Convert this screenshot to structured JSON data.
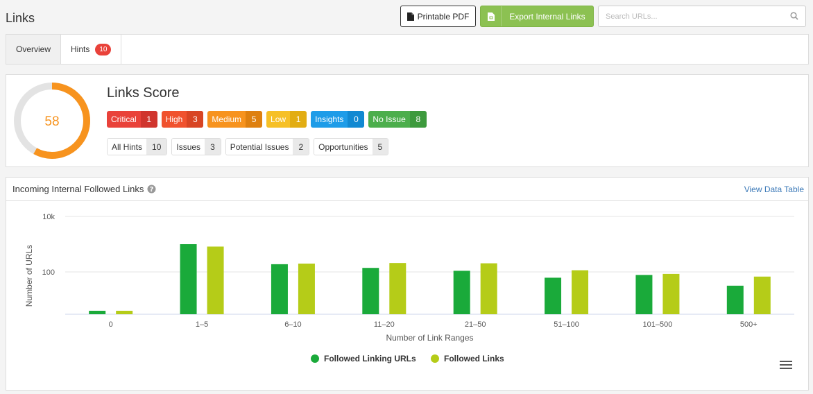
{
  "page": {
    "title": "Links"
  },
  "toolbar": {
    "pdf_label": "Printable PDF",
    "export_label": "Export Internal Links"
  },
  "search": {
    "placeholder": "Search URLs..."
  },
  "tabs": [
    {
      "label": "Overview",
      "active": true
    },
    {
      "label": "Hints",
      "badge": "10",
      "active": false
    }
  ],
  "score": {
    "title": "Links Score",
    "value": "58",
    "fraction": 0.58,
    "ring_color": "#f7931e",
    "severities": [
      {
        "label": "Critical",
        "count": "1",
        "color": "#e9423a",
        "dark": "#d0352e"
      },
      {
        "label": "High",
        "count": "3",
        "color": "#f0522e",
        "dark": "#d84524"
      },
      {
        "label": "Medium",
        "count": "5",
        "color": "#f7931e",
        "dark": "#de8010"
      },
      {
        "label": "Low",
        "count": "1",
        "color": "#f6c026",
        "dark": "#e2ad13"
      },
      {
        "label": "Insights",
        "count": "0",
        "color": "#1e9ce8",
        "dark": "#1189d2"
      },
      {
        "label": "No Issue",
        "count": "8",
        "color": "#4cae4c",
        "dark": "#3d9a3d"
      }
    ],
    "counts": [
      {
        "label": "All Hints",
        "count": "10"
      },
      {
        "label": "Issues",
        "count": "3"
      },
      {
        "label": "Potential Issues",
        "count": "2"
      },
      {
        "label": "Opportunities",
        "count": "5"
      }
    ]
  },
  "chart_panel": {
    "title": "Incoming Internal Followed Links",
    "view_link": "View Data Table"
  },
  "chart_data": {
    "type": "bar",
    "title": "",
    "xlabel": "Number of Link Ranges",
    "ylabel": "Number of URLs",
    "y_scale": "log",
    "ylim": [
      3,
      10000
    ],
    "y_ticks": [
      {
        "value": 10000,
        "label": "10k"
      },
      {
        "value": 100,
        "label": "100"
      }
    ],
    "categories": [
      "0",
      "1–5",
      "6–10",
      "11–20",
      "21–50",
      "51–100",
      "101–500",
      "500+"
    ],
    "series": [
      {
        "name": "Followed Linking URLs",
        "color": "#1aaa3a",
        "values": [
          4,
          1000,
          190,
          140,
          110,
          62,
          78,
          32
        ]
      },
      {
        "name": "Followed Links",
        "color": "#b5cc18",
        "values": [
          4,
          820,
          200,
          210,
          205,
          115,
          85,
          68
        ]
      }
    ],
    "legend": "bottom-center",
    "grid": true
  }
}
